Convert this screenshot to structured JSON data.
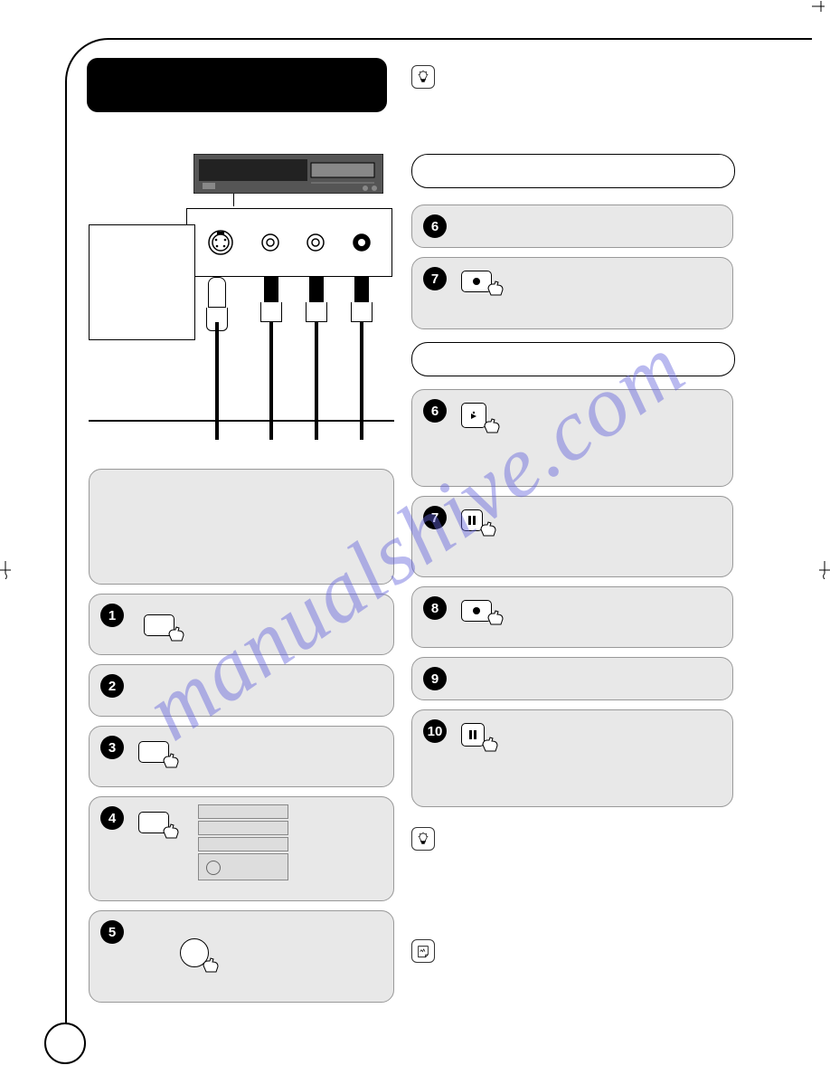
{
  "watermark": "manualshive.com",
  "left_steps": [
    "1",
    "2",
    "3",
    "4",
    "5"
  ],
  "right_steps_a": [
    "6",
    "7"
  ],
  "right_steps_b": [
    "6",
    "7",
    "8",
    "9",
    "10"
  ],
  "icons": {
    "lightbulb": "lightbulb-icon",
    "note": "note-icon",
    "record": "●",
    "play": "▶",
    "pause": "‖"
  }
}
